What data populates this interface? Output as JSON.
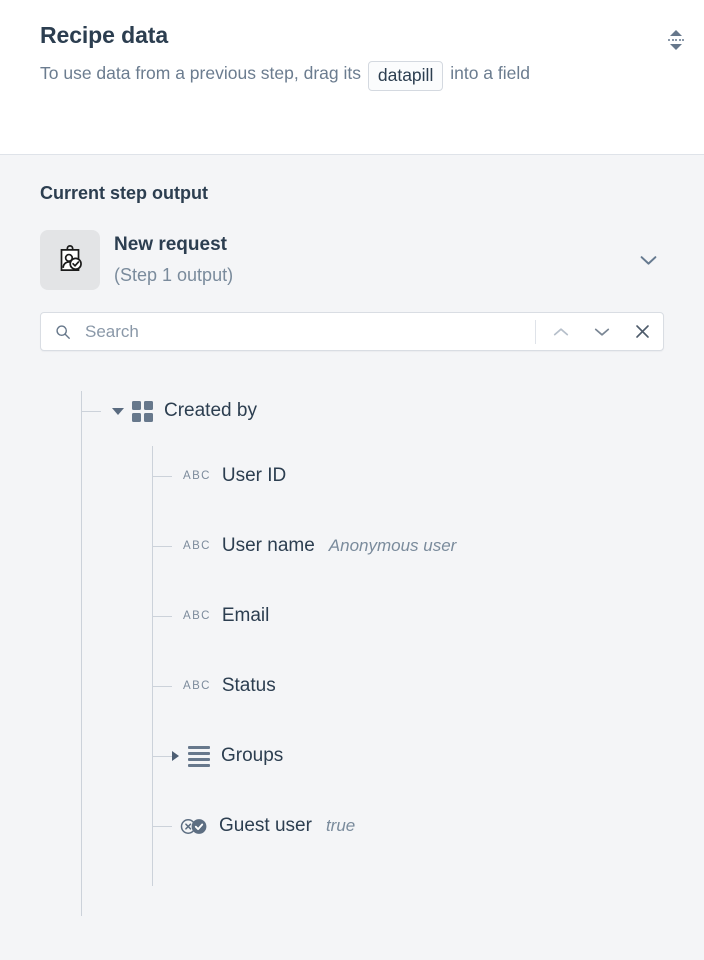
{
  "header": {
    "title": "Recipe data",
    "subtitle_before": "To use data from a previous step, drag its",
    "datapill_chip": "datapill",
    "subtitle_after": "into a field",
    "resize_handle_icon": "vertical-resize-icon"
  },
  "body": {
    "section_label": "Current step output",
    "step": {
      "icon": "approval-request-clipboard-icon",
      "name": "New request",
      "subtitle": "(Step 1 output)",
      "collapse_icon": "chevron-down-icon"
    },
    "search": {
      "placeholder": "Search",
      "value": "",
      "search_icon": "search-icon",
      "prev_icon": "chevron-up-icon",
      "next_icon": "chevron-down-icon",
      "clear_icon": "close-icon"
    },
    "tree": {
      "nodes": [
        {
          "label": "Created by",
          "type_icon": "object-grid-icon",
          "caret": "expanded",
          "value": ""
        },
        {
          "label": "User ID",
          "type_icon": "abc-string-icon",
          "type_text": "ABC",
          "value": ""
        },
        {
          "label": "User name",
          "type_icon": "abc-string-icon",
          "type_text": "ABC",
          "value": "Anonymous user"
        },
        {
          "label": "Email",
          "type_icon": "abc-string-icon",
          "type_text": "ABC",
          "value": ""
        },
        {
          "label": "Status",
          "type_icon": "abc-string-icon",
          "type_text": "ABC",
          "value": ""
        },
        {
          "label": "Groups",
          "type_icon": "list-array-icon",
          "caret": "collapsed",
          "value": ""
        },
        {
          "label": "Guest user",
          "type_icon": "boolean-icon",
          "value": "true"
        }
      ]
    }
  },
  "colors": {
    "text_dark": "#2c3e50",
    "text_muted": "#7a8b9c",
    "icon_slate": "#67788c",
    "line": "#ccd2da",
    "panel_bg": "#f4f5f7",
    "header_bg": "#ffffff"
  }
}
